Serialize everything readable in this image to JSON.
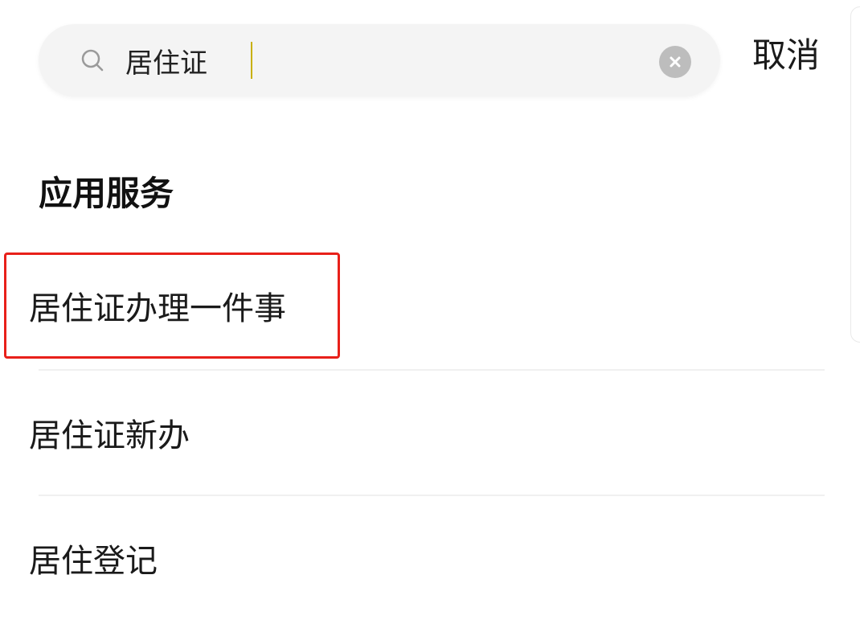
{
  "search": {
    "value": "居住证",
    "placeholder": ""
  },
  "header": {
    "cancel_label": "取消"
  },
  "section": {
    "title": "应用服务"
  },
  "results": [
    {
      "label": "居住证办理一件事"
    },
    {
      "label": "居住证新办"
    },
    {
      "label": "居住登记"
    }
  ],
  "colors": {
    "highlight": "#e8201a",
    "search_bg": "#f4f4f4",
    "clear_icon": "#bdbdbd"
  },
  "icons": {
    "search": "search-icon",
    "clear": "clear-icon"
  }
}
